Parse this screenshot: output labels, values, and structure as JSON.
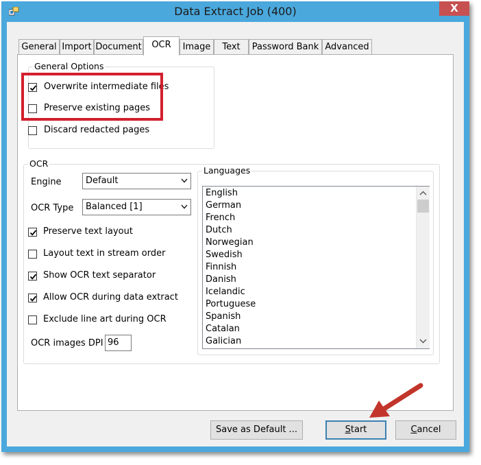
{
  "window": {
    "title": "Data Extract Job (400)",
    "close_glyph": "X"
  },
  "tabs": [
    {
      "label": "General"
    },
    {
      "label": "Import"
    },
    {
      "label": "Document"
    },
    {
      "label": "OCR",
      "active": true
    },
    {
      "label": "Image"
    },
    {
      "label": "Text"
    },
    {
      "label": "Password Bank"
    },
    {
      "label": "Advanced"
    }
  ],
  "general_options": {
    "legend": "General Options",
    "overwrite": {
      "label": "Overwrite intermediate files",
      "checked": true
    },
    "preserve": {
      "label": "Preserve existing pages",
      "checked": false
    },
    "discard": {
      "label": "Discard redacted pages",
      "checked": false
    }
  },
  "ocr": {
    "legend": "OCR",
    "engine_label": "Engine",
    "engine_value": "Default",
    "ocr_type_label": "OCR Type",
    "ocr_type_value": "Balanced [1]",
    "preserve_layout": {
      "label": "Preserve text layout",
      "checked": true
    },
    "stream_order": {
      "label": "Layout text in stream order",
      "checked": false
    },
    "separator": {
      "label": "Show OCR text separator",
      "checked": true
    },
    "allow_ocr": {
      "label": "Allow OCR during data extract",
      "checked": true
    },
    "exclude_line_art": {
      "label": "Exclude line art during OCR",
      "checked": false
    },
    "dpi_label": "OCR images DPI",
    "dpi_value": "96"
  },
  "languages": {
    "legend": "Languages",
    "items": [
      "English",
      "German",
      "French",
      "Dutch",
      "Norwegian",
      "Swedish",
      "Finnish",
      "Danish",
      "Icelandic",
      "Portuguese",
      "Spanish",
      "Catalan",
      "Galician"
    ]
  },
  "buttons": {
    "save_default": "Save as Default ...",
    "start_first": "S",
    "start_rest": "tart",
    "cancel_first": "C",
    "cancel_rest": "ancel"
  },
  "colors": {
    "highlight_box": "#d21f2d",
    "annotation_arrow": "#c2352b",
    "title_bar": "#4aa8dc"
  }
}
